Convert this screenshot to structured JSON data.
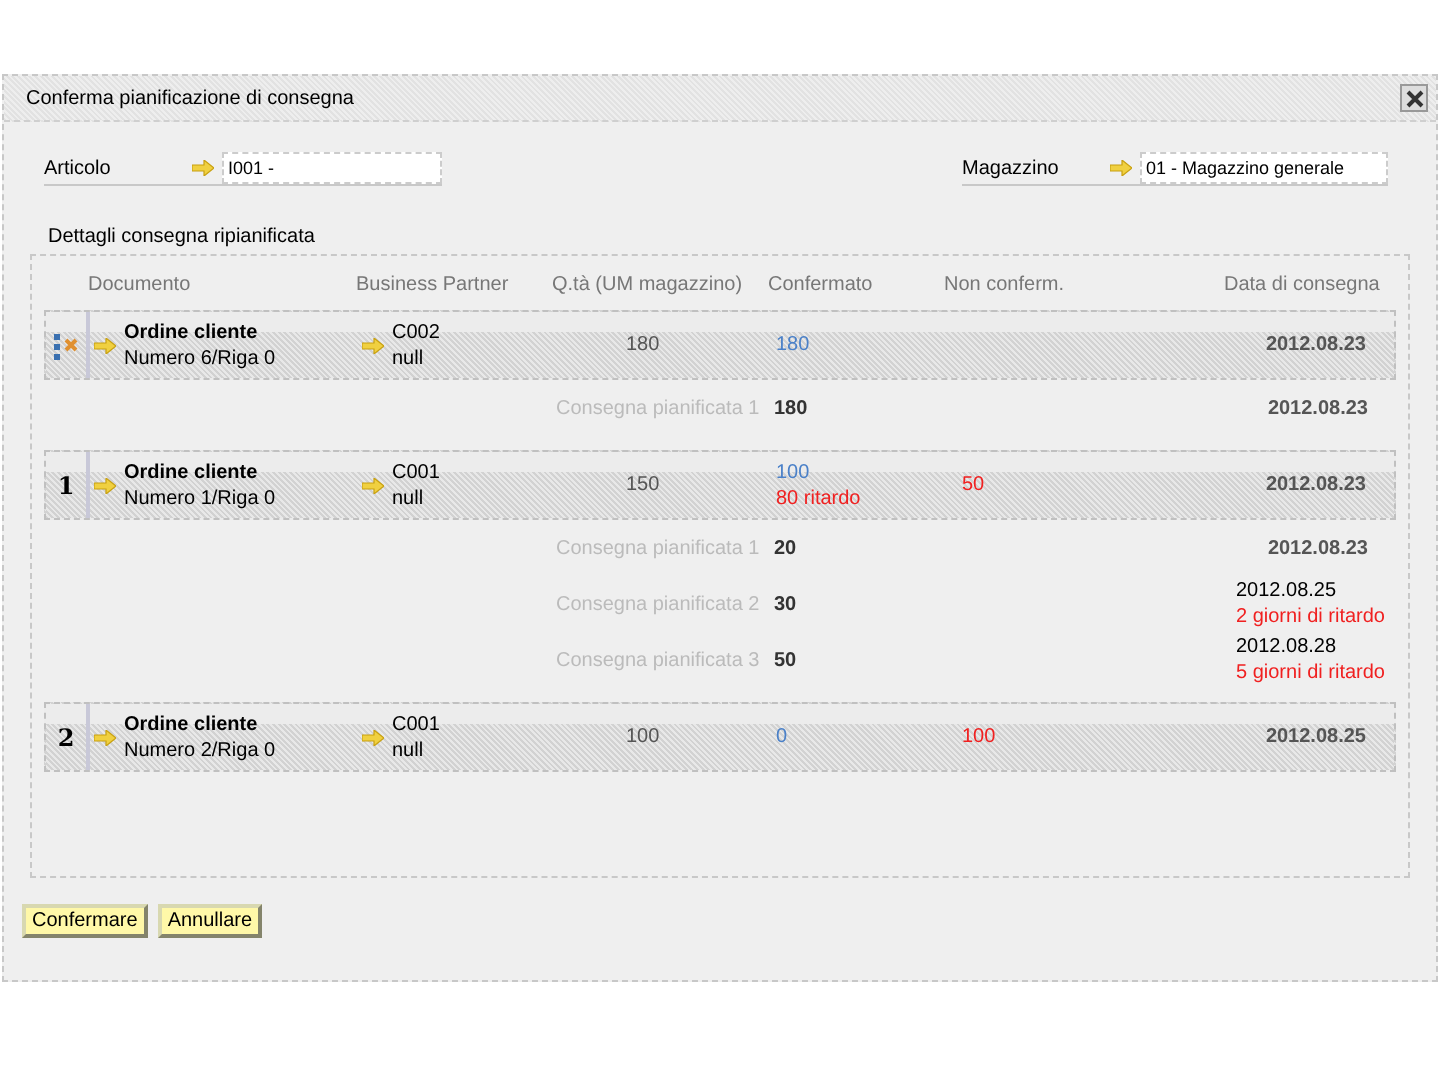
{
  "window": {
    "title": "Conferma pianificazione di consegna"
  },
  "fields": [
    {
      "label": "Articolo",
      "value": "I001 -"
    },
    {
      "label": "Magazzino",
      "value": "01 - Magazzino generale"
    }
  ],
  "section_title": "Dettagli consegna ripianificata",
  "table": {
    "columns": [
      "Documento",
      "Business Partner",
      "Q.tà (UM magazzino)",
      "Confermato",
      "Non conferm.",
      "Data di consegna"
    ],
    "rows": [
      {
        "document": "Ordine cliente",
        "number": "Numero 6/Riga 0",
        "partner_code": "C002",
        "partner_name": "null",
        "quantity": "180",
        "confirmed": "180",
        "date": "2012.08.23",
        "deliveries": [
          {
            "label": "Consegna pianificata 1",
            "quantity": "180",
            "date": "2012.08.23"
          }
        ]
      },
      {
        "marker": "1",
        "document": "Ordine cliente",
        "number": "Numero 1/Riga 0",
        "partner_code": "C001",
        "partner_name": "null",
        "quantity": "150",
        "confirmed": "100",
        "confirmed_delay": "80 ritardo",
        "unconfirmed": "50",
        "date": "2012.08.23",
        "deliveries": [
          {
            "label": "Consegna pianificata 1",
            "quantity": "20",
            "date": "2012.08.23"
          },
          {
            "label": "Consegna pianificata 2",
            "quantity": "30",
            "date": "2012.08.25",
            "delay": "2 giorni di ritardo"
          },
          {
            "label": "Consegna pianificata 3",
            "quantity": "50",
            "date": "2012.08.28",
            "delay": "5 giorni di ritardo"
          }
        ]
      },
      {
        "marker": "2",
        "document": "Ordine cliente",
        "number": "Numero 2/Riga 0",
        "partner_code": "C001",
        "partner_name": "null",
        "quantity": "100",
        "confirmed": "0",
        "unconfirmed": "100",
        "date": "2012.08.25",
        "deliveries": []
      }
    ]
  },
  "buttons": [
    "Confermare",
    "Annullare"
  ]
}
